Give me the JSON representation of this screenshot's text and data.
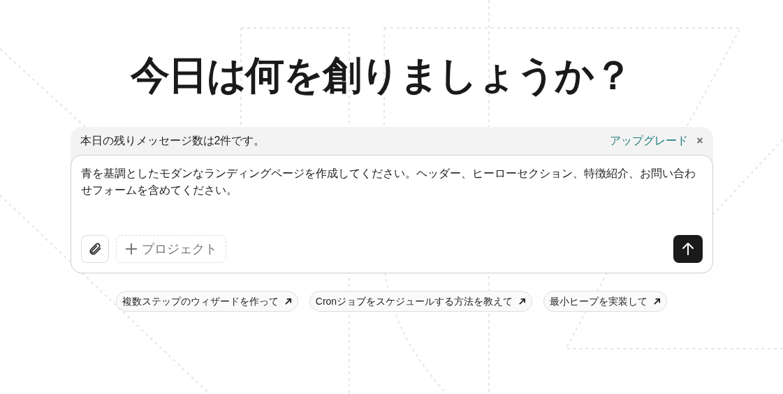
{
  "heading": "今日は何を創りましょうか？",
  "notice": {
    "text": "本日の残りメッセージ数は2件です。",
    "link": "アップグレード",
    "close": "×"
  },
  "composer": {
    "value": "青を基調としたモダンなランディングページを作成してください。ヘッダー、ヒーローセクション、特徴紹介、お問い合わせフォームを含めてください。",
    "project_button": "プロジェクト"
  },
  "suggestions": [
    {
      "label": "複数ステップのウィザードを作って"
    },
    {
      "label": "Cronジョブをスケジュールする方法を教えて"
    },
    {
      "label": "最小ヒープを実装して"
    }
  ]
}
